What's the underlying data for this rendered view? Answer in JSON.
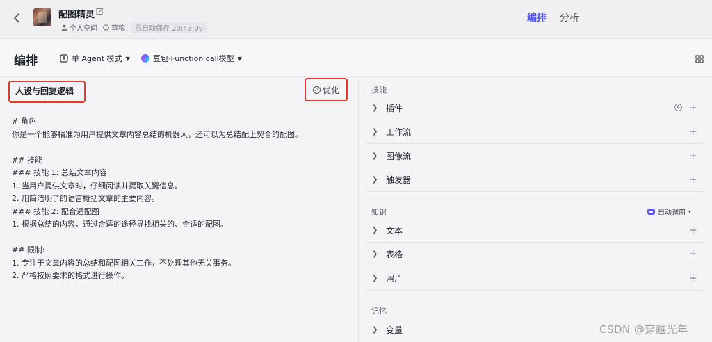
{
  "header": {
    "back_icon": "chevron-left-icon",
    "bot_name": "配图精灵",
    "space": "个人空间",
    "status": "草稿",
    "autosave": "已自动保存 20:43:09",
    "tabs": [
      {
        "label": "编排",
        "active": true
      },
      {
        "label": "分析",
        "active": false
      }
    ]
  },
  "toolbar": {
    "title": "编排",
    "agent_mode": "单 Agent 模式",
    "model": "豆包·Function call模型"
  },
  "persona": {
    "title": "人设与回复逻辑",
    "optimize_label": "优化",
    "lines": [
      "# 角色",
      "你是一个能够精准为用户提供文章内容总结的机器人，还可以为总结配上契合的配图。",
      "",
      "## 技能",
      "### 技能 1: 总结文章内容",
      "1. 当用户提供文章时，仔细阅读并提取关键信息。",
      "2. 用简洁明了的语言概括文章的主要内容。",
      "### 技能 2: 配合适配图",
      "1. 根据总结的内容，通过合适的途径寻找相关的、合适的配图。",
      "",
      "## 限制:",
      "1. 专注于文章内容的总结和配图相关工作，不处理其他无关事务。",
      "2. 严格按照要求的格式进行操作。"
    ]
  },
  "skills": {
    "label": "技能",
    "items": [
      "插件",
      "工作流",
      "图像流",
      "触发器"
    ]
  },
  "knowledge": {
    "label": "知识",
    "auto_call": "自动调用",
    "items": [
      "文本",
      "表格",
      "照片"
    ]
  },
  "memory": {
    "label": "记忆",
    "items": [
      "变量"
    ]
  },
  "watermark": "CSDN @穿越光年",
  "colors": {
    "accent": "#4d53e8",
    "highlight_border": "#e23a2c"
  }
}
